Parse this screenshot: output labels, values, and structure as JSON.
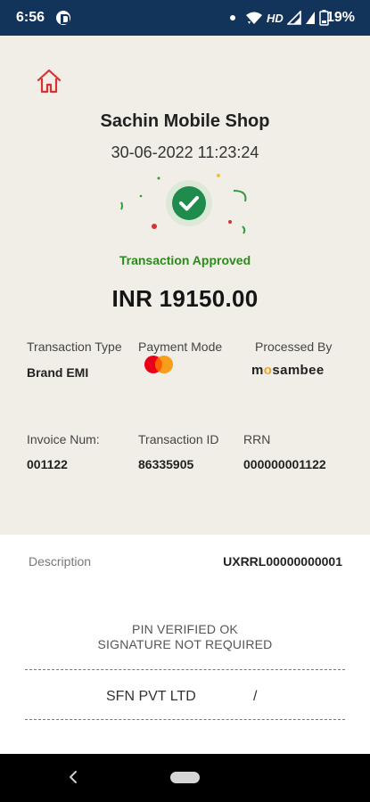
{
  "status_bar": {
    "time": "6:56",
    "network": "HD",
    "battery": "19%",
    "bg_color": "#13345a"
  },
  "receipt": {
    "merchant_name": "Sachin Mobile Shop",
    "datetime": "30-06-2022 11:23:24",
    "status": "Transaction Approved",
    "amount": "INR 19150.00",
    "status_color": "#2b8a1b",
    "home_icon": "home-icon",
    "success_icon": "check-circle-icon",
    "details_row1": {
      "transaction_type_label": "Transaction Type",
      "transaction_type_value": "Brand EMI",
      "payment_mode_label": "Payment Mode",
      "payment_mode_icon": "mastercard-icon",
      "processed_by_label": "Processed By",
      "processed_by_logo": "mosambee"
    },
    "details_row2": {
      "invoice_label": "Invoice Num:",
      "invoice_value": "001122",
      "transaction_id_label": "Transaction ID",
      "transaction_id_value": "86335905",
      "rrn_label": "RRN",
      "rrn_value": "000000001122"
    }
  },
  "footer": {
    "description_label": "Description",
    "description_value": "UXRRL00000000001",
    "pin_status": "PIN VERIFIED OK",
    "signature_status": "SIGNATURE NOT REQUIRED",
    "company": "SFN PVT LTD",
    "company_suffix": "/"
  }
}
